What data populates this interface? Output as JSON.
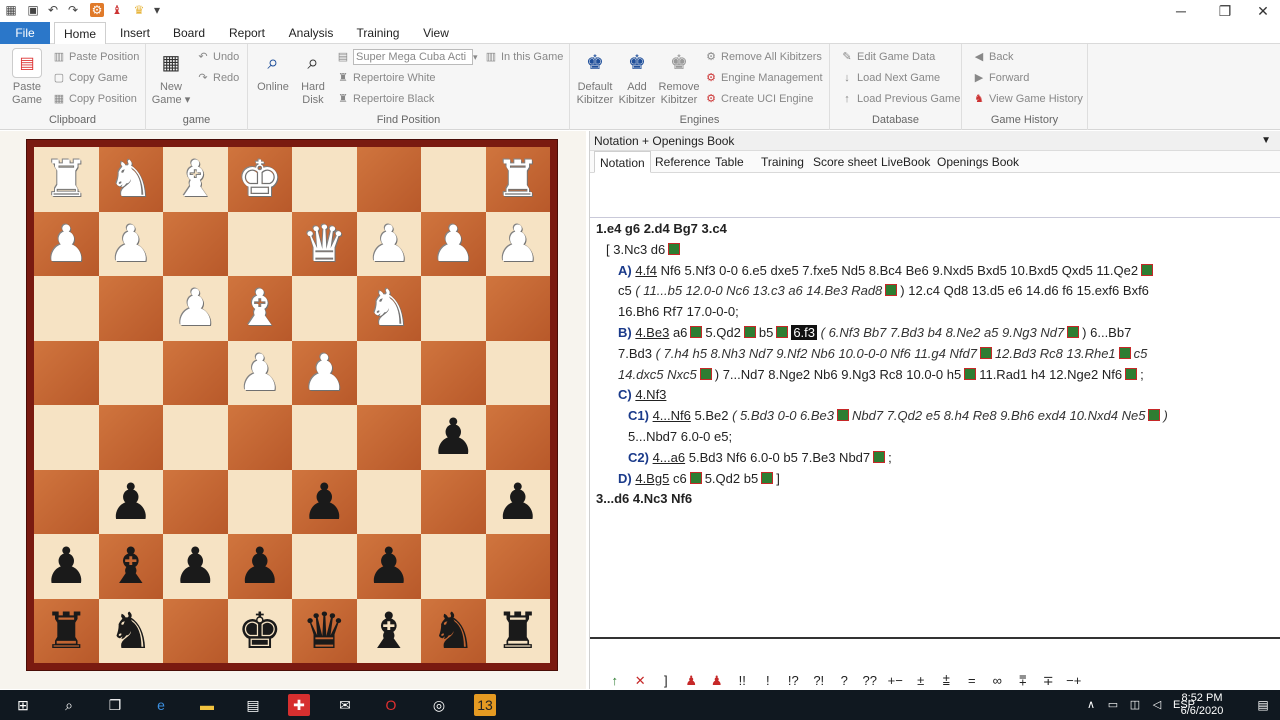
{
  "menu": {
    "file": "File",
    "home": "Home",
    "insert": "Insert",
    "board": "Board",
    "report": "Report",
    "analysis": "Analysis",
    "training": "Training",
    "view": "View"
  },
  "ribbon": {
    "clipboard": {
      "paste_game": "Paste Game",
      "paste_position": "Paste Position",
      "copy_game": "Copy Game",
      "copy_position": "Copy Position",
      "label": "Clipboard"
    },
    "game": {
      "new_game": "New Game ▾",
      "undo": "Undo",
      "redo": "Redo",
      "label": "game"
    },
    "find": {
      "online": "Online",
      "hard_disk": "Hard Disk",
      "search_value": "Super Mega Cuba Acti",
      "in_this_game": "In this Game",
      "repertoire_white": "Repertoire White",
      "repertoire_black": "Repertoire Black",
      "label": "Find Position"
    },
    "engines": {
      "default_kibitzer": "Default Kibitzer",
      "add_kibitzer": "Add Kibitzer",
      "remove_kibitzer": "Remove Kibitzer",
      "remove_all": "Remove All Kibitzers",
      "engine_management": "Engine Management",
      "create_uci": "Create UCI Engine",
      "label": "Engines"
    },
    "database": {
      "edit_game_data": "Edit Game Data",
      "load_next": "Load Next Game",
      "load_previous": "Load Previous Game",
      "label": "Database"
    },
    "history": {
      "back": "Back",
      "forward": "Forward",
      "view_history": "View Game History",
      "label": "Game History"
    }
  },
  "board": {
    "ranks": [
      [
        "bR-w",
        "bN-w",
        "bB-w",
        "bK-w",
        "",
        "",
        "",
        "bR-w"
      ],
      [
        "bP-w",
        "bP-w",
        "",
        "",
        "bQ-w",
        "bP-w",
        "bP-w",
        "bP-w"
      ],
      [
        "",
        "",
        "bP-w",
        "bB-w",
        "",
        "bN-w",
        "",
        ""
      ],
      [
        "",
        "",
        "",
        "bP-w",
        "bP-w",
        "",
        "",
        ""
      ],
      [
        "",
        "",
        "",
        "",
        "",
        "",
        "bP-b",
        ""
      ],
      [
        "",
        "bP-b",
        "",
        "",
        "bP-b",
        "",
        "",
        "bP-b"
      ],
      [
        "bP-b",
        "bB-b",
        "bP-b",
        "bP-b",
        "",
        "bP-b",
        "",
        ""
      ],
      [
        "bR-b",
        "bN-b",
        "",
        "bK-b",
        "bQ-b",
        "bB-b",
        "bN-b",
        "bR-b"
      ]
    ]
  },
  "panel": {
    "title": "Notation + Openings Book",
    "tabs": [
      "Notation",
      "Reference",
      "Table",
      "Training",
      "Score sheet",
      "LiveBook",
      "Openings Book"
    ]
  },
  "notation": {
    "line1": "1.e4  g6  2.d4  Bg7  3.c4",
    "line2a": "[ 3.Nc3  d6",
    "line3": [
      "A)",
      "4.f4",
      "Nf6  5.Nf3  0-0  6.e5  dxe5  7.fxe5  Nd5  8.Bc4  Be6  9.Nxd5  Bxd5  10.Bxd5  Qxd5  11.Qe2"
    ],
    "line4a": "c5",
    "line4b": "( 11...b5  12.0-0  Nc6  13.c3  a6  14.Be3  Rad8",
    "line4c": ") 12.c4  Qd8  13.d5  e6  14.d6  f6  15.exf6  Bxf6",
    "line5": "16.Bh6  Rf7  17.0-0-0;",
    "line6": [
      "B)",
      "4.Be3",
      "a6",
      "5.Qd2",
      "b5",
      "6.f3",
      "( 6.Nf3  Bb7  7.Bd3  b4  8.Ne2  a5  9.Ng3  Nd7",
      ") 6...Bb7"
    ],
    "line7a": "7.Bd3",
    "line7b": "( 7.h4  h5  8.Nh3  Nd7  9.Nf2  Nb6  10.0-0-0  Nf6  11.g4  Nfd7",
    "line7c": "12.Bd3  Rc8  13.Rhe1",
    "line7d": "c5",
    "line8a": "14.dxc5  Nxc5",
    "line8b": ") 7...Nd7  8.Nge2  Nb6  9.Ng3  Rc8  10.0-0  h5",
    "line8c": "11.Rad1  h4  12.Nge2  Nf6",
    "line8d": ";",
    "line9": [
      "C)",
      "4.Nf3"
    ],
    "line10": [
      "C1)",
      "4...Nf6",
      "5.Be2",
      "( 5.Bd3  0-0  6.Be3",
      "Nbd7  7.Qd2  e5  8.h4  Re8  9.Bh6  exd4  10.Nxd4  Ne5",
      ")"
    ],
    "line11": "5...Nbd7  6.0-0  e5;",
    "line12": [
      "C2)",
      "4...a6",
      "5.Bd3  Nf6  6.0-0  b5  7.Be3  Nbd7",
      ";"
    ],
    "line13": [
      "D)",
      "4.Bg5",
      "c6",
      "5.Qd2  b5",
      "]"
    ],
    "line14": "3...d6  4.Nc3  Nf6"
  },
  "symbols": [
    "↑",
    "✕",
    "]",
    "♟",
    "♟",
    "!!",
    "!",
    "!?",
    "?!",
    "?",
    "??",
    "+−",
    "±",
    "⩲",
    "=",
    "∞",
    "⩱",
    "∓",
    "−+"
  ],
  "clock": {
    "time": "8:52 PM",
    "date": "6/6/2020",
    "lang": "ESP"
  }
}
